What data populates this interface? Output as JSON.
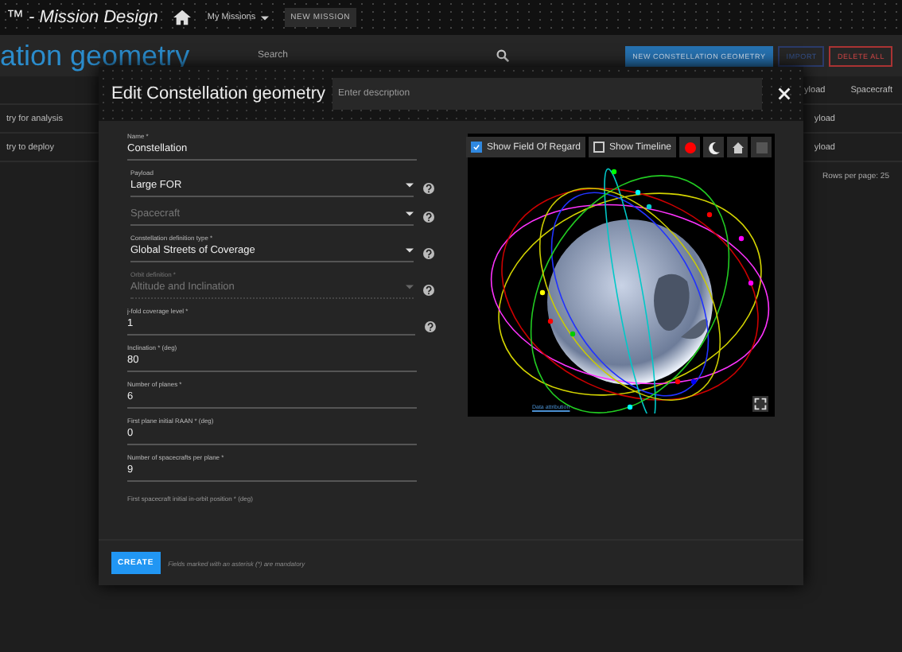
{
  "top_bar": {
    "app_title": "™ - Mission Design",
    "menu": "My Missions",
    "new_mission": "NEW MISSION"
  },
  "page": {
    "title": "ation geometry",
    "search": {
      "placeholder": "Search"
    },
    "buttons": [
      {
        "label": "NEW CONSTELLATION GEOMETRY",
        "kind": "primary"
      },
      {
        "label": "IMPORT",
        "kind": "dim"
      },
      {
        "label": "DELETE ALL",
        "kind": "danger"
      }
    ]
  },
  "table": {
    "columns": [
      "yload",
      "Spacecraft"
    ],
    "rows": [
      {
        "name": "try for analysis",
        "payload": "yload"
      },
      {
        "name": "try to deploy",
        "payload": "yload"
      }
    ],
    "rows_per_page": "Rows per page: 25"
  },
  "dialog": {
    "title": "Edit Constellation geometry",
    "description": {
      "placeholder": "Enter description"
    },
    "fields": [
      {
        "kind": "text",
        "label": "Name *",
        "value": "Constellation",
        "help": false,
        "disabled": false
      },
      {
        "kind": "select",
        "label": "Payload",
        "value": "Large FOR",
        "help": true,
        "disabled": false
      },
      {
        "kind": "select",
        "placeholder": "Spacecraft",
        "help": true,
        "disabled": false
      },
      {
        "kind": "select",
        "label": "Constellation definition type *",
        "value": "Global Streets of Coverage",
        "help": true,
        "disabled": false
      },
      {
        "kind": "select",
        "label": "Orbit definition *",
        "value": "Altitude and Inclination",
        "help": true,
        "disabled": true
      },
      {
        "kind": "text",
        "label": "j-fold coverage level *",
        "value": "1",
        "help": true,
        "disabled": false
      },
      {
        "kind": "text",
        "label": "Inclination * (deg)",
        "value": "80",
        "help": false,
        "disabled": false
      },
      {
        "kind": "text",
        "label": "Number of planes *",
        "value": "6",
        "help": false,
        "disabled": false
      },
      {
        "kind": "text",
        "label": "First plane initial RAAN * (deg)",
        "value": "0",
        "help": false,
        "disabled": false
      },
      {
        "kind": "text",
        "label": "Number of spacecrafts per plane *",
        "value": "9",
        "help": false,
        "disabled": false
      },
      {
        "kind": "label",
        "label": "First spacecraft initial in-orbit position * (deg)"
      }
    ],
    "viewer": {
      "toggles": [
        {
          "label": "Show Field Of Regard",
          "checked": true
        },
        {
          "label": "Show Timeline",
          "checked": false
        }
      ],
      "attribution": "Data attribution"
    },
    "create": "CREATE",
    "note": "Fields marked with an asterisk (*) are mandatory"
  }
}
